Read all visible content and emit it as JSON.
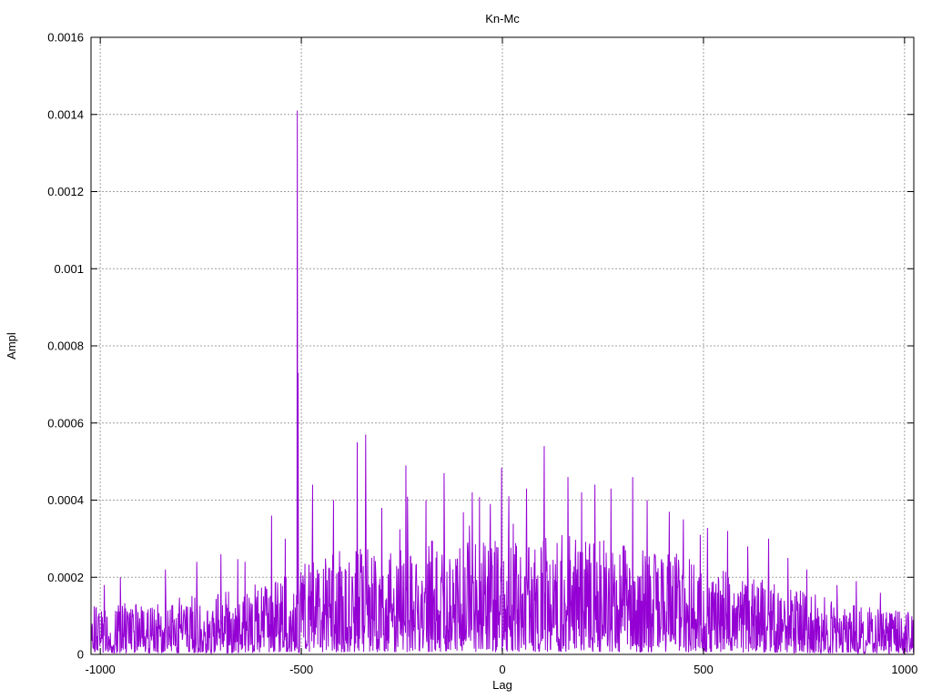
{
  "chart_data": {
    "type": "line",
    "style": "noisy-impulse-correlation-trace",
    "title": "Kn-Mc",
    "xlabel": "Lag",
    "ylabel": "Ampl",
    "xlim": [
      -1023,
      1023
    ],
    "ylim": [
      0,
      0.0016
    ],
    "xticks": [
      -1000,
      -500,
      0,
      500,
      1000
    ],
    "xtick_labels": [
      "-1000",
      "-500",
      "0",
      "500",
      "1000"
    ],
    "yticks": [
      0,
      0.0002,
      0.0004,
      0.0006,
      0.0008,
      0.001,
      0.0012,
      0.0014,
      0.0016
    ],
    "ytick_labels": [
      "0",
      "0.0002",
      "0.0004",
      "0.0006",
      "0.0008",
      "0.001",
      "0.0012",
      "0.0014",
      "0.0016"
    ],
    "grid": true,
    "legend": "none",
    "line_color": "#9400D3",
    "grid_color": "#A0A0A0",
    "border_color": "#000000",
    "background_color": "#FFFFFF",
    "main_peak": {
      "x": -510,
      "y": 0.00141
    },
    "n_points": 2047,
    "step": 1,
    "noise_seed": 20,
    "noise_exponent": 1.6,
    "noise_floor_fraction": 0.02,
    "burst_probability": 0.025,
    "envelope": [
      [
        -1023,
        0.00013
      ],
      [
        -900,
        0.00014
      ],
      [
        -800,
        0.00015
      ],
      [
        -700,
        0.00016
      ],
      [
        -620,
        0.00018
      ],
      [
        -560,
        0.0002
      ],
      [
        -520,
        0.00023
      ],
      [
        -480,
        0.00025
      ],
      [
        -420,
        0.00027
      ],
      [
        -360,
        0.00028
      ],
      [
        -300,
        0.00028
      ],
      [
        -240,
        0.00029
      ],
      [
        -180,
        0.0003
      ],
      [
        -120,
        0.0003
      ],
      [
        -60,
        0.0003
      ],
      [
        0,
        0.0003
      ],
      [
        60,
        0.00031
      ],
      [
        120,
        0.00032
      ],
      [
        180,
        0.00031
      ],
      [
        240,
        0.0003
      ],
      [
        300,
        0.00029
      ],
      [
        360,
        0.00028
      ],
      [
        420,
        0.00027
      ],
      [
        480,
        0.00025
      ],
      [
        540,
        0.00023
      ],
      [
        600,
        0.00021
      ],
      [
        660,
        0.00019
      ],
      [
        720,
        0.00017
      ],
      [
        780,
        0.00016
      ],
      [
        840,
        0.00014
      ],
      [
        900,
        0.00013
      ],
      [
        960,
        0.00012
      ],
      [
        1023,
        0.00011
      ]
    ],
    "peaks": [
      [
        -990,
        0.00018
      ],
      [
        -950,
        0.0002
      ],
      [
        -838,
        0.00022
      ],
      [
        -760,
        0.00024
      ],
      [
        -700,
        0.00026
      ],
      [
        -640,
        0.00024
      ],
      [
        -574,
        0.00036
      ],
      [
        -540,
        0.0003
      ],
      [
        -510,
        0.00141
      ],
      [
        -508,
        0.00073
      ],
      [
        -472,
        0.00044
      ],
      [
        -420,
        0.0004
      ],
      [
        -361,
        0.00055
      ],
      [
        -300,
        0.00038
      ],
      [
        -240,
        0.00049
      ],
      [
        -190,
        0.0004
      ],
      [
        -145,
        0.00047
      ],
      [
        -75,
        0.00042
      ],
      [
        -30,
        0.00039
      ],
      [
        16,
        0.00041
      ],
      [
        60,
        0.00043
      ],
      [
        104,
        0.00054
      ],
      [
        163,
        0.00046
      ],
      [
        197,
        0.00042
      ],
      [
        230,
        0.00044
      ],
      [
        270,
        0.00043
      ],
      [
        324,
        0.00046
      ],
      [
        360,
        0.0004
      ],
      [
        415,
        0.00037
      ],
      [
        450,
        0.00035
      ],
      [
        492,
        0.00031
      ],
      [
        560,
        0.00032
      ],
      [
        610,
        0.00028
      ],
      [
        662,
        0.0003
      ],
      [
        710,
        0.00025
      ],
      [
        757,
        0.00022
      ],
      [
        832,
        0.00018
      ],
      [
        880,
        0.00019
      ],
      [
        940,
        0.00016
      ]
    ]
  }
}
